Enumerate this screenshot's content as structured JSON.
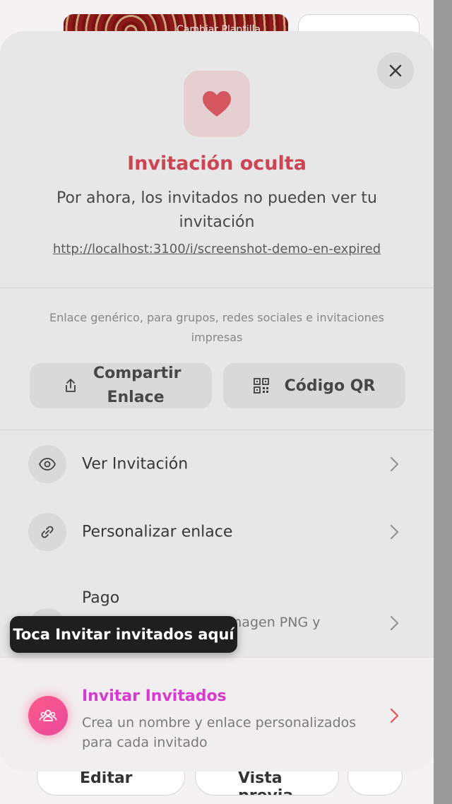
{
  "background": {
    "banner_text": "Cambiar Plantilla",
    "edit_label": "Editar",
    "preview_label": "Vista previa"
  },
  "sheet": {
    "title": "Invitación oculta",
    "subtitle": "Por ahora, los invitados no pueden ver tu invitación",
    "url": "http://localhost:3100/i/screenshot-demo-en-expired",
    "generic_note": "Enlace genérico, para grupos, redes sociales e invitaciones impresas",
    "share_button": "Compartir Enlace",
    "qr_button": "Código QR",
    "rows": [
      {
        "label": "Ver Invitación",
        "icon": "eye-icon"
      },
      {
        "label": "Personalizar enlace",
        "icon": "link-icon"
      }
    ],
    "pago": {
      "title": "Pago",
      "description": "Invitación lista como imagen PNG y"
    },
    "invite": {
      "title": "Invitar Invitados",
      "description": "Crea un nombre y enlace personalizados para cada invitado"
    }
  },
  "tooltip": "Toca Invitar invitados aquí",
  "colors": {
    "accent_red": "#e03a4a",
    "invite_magenta": "#d63ad0",
    "heart": "#e8505b"
  }
}
